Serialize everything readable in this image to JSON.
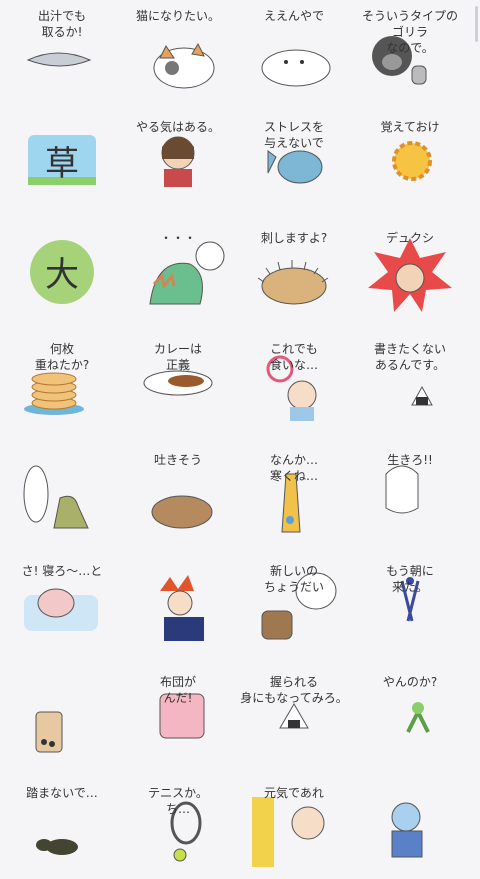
{
  "stickers": [
    {
      "name": "sticker-dashi",
      "lines": [
        "出汁でも",
        "取るか!"
      ]
    },
    {
      "name": "sticker-cat",
      "lines": [
        "猫になりたい。"
      ]
    },
    {
      "name": "sticker-seal",
      "lines": [
        "ええんやで"
      ]
    },
    {
      "name": "sticker-gorilla",
      "lines": [
        "そういうタイプの",
        "ゴリラ",
        "なので。"
      ]
    },
    {
      "name": "sticker-kusa",
      "lines": [
        "草"
      ]
    },
    {
      "name": "sticker-girl",
      "lines": [
        "やる気はある。"
      ]
    },
    {
      "name": "sticker-sunfish",
      "lines": [
        "ストレスを",
        "与えないで"
      ]
    },
    {
      "name": "sticker-sun",
      "lines": [
        "覚えておけ"
      ]
    },
    {
      "name": "sticker-dai",
      "lines": [
        "大"
      ]
    },
    {
      "name": "sticker-dino-dots",
      "lines": [
        "・・・"
      ]
    },
    {
      "name": "sticker-hedgehog",
      "lines": [
        "刺しますよ?"
      ]
    },
    {
      "name": "sticker-deuce",
      "lines": [
        "デュクシ"
      ]
    },
    {
      "name": "sticker-pancake",
      "lines": [
        "何枚",
        "重ねたか?"
      ]
    },
    {
      "name": "sticker-curry",
      "lines": [
        "カレーは",
        "正義"
      ]
    },
    {
      "name": "sticker-baby",
      "lines": [
        "これでも",
        "食いな…"
      ]
    },
    {
      "name": "sticker-onigiri",
      "lines": [
        "書きたくない",
        "あるんです。"
      ]
    },
    {
      "name": "sticker-dino-roar",
      "lines": []
    },
    {
      "name": "sticker-squirrel",
      "lines": [
        "吐きそう"
      ]
    },
    {
      "name": "sticker-giraffe",
      "lines": [
        "なんか…",
        "寒くね…"
      ]
    },
    {
      "name": "sticker-ghost",
      "lines": [
        "生きろ!!"
      ]
    },
    {
      "name": "sticker-pig",
      "lines": [
        "さ! 寝ろ〜…と"
      ]
    },
    {
      "name": "sticker-redhair",
      "lines": []
    },
    {
      "name": "sticker-bear",
      "lines": [
        "新しいの",
        "ちょうだい"
      ]
    },
    {
      "name": "sticker-compass",
      "lines": [
        "もう朝に",
        "来た。"
      ]
    },
    {
      "name": "sticker-boba",
      "lines": []
    },
    {
      "name": "sticker-futon",
      "lines": [
        "布団が",
        "んだ!"
      ]
    },
    {
      "name": "sticker-riceball-thought",
      "lines": [
        "握られる",
        "身にもなってみろ。"
      ]
    },
    {
      "name": "sticker-mantis",
      "lines": [
        "やんのか?"
      ]
    },
    {
      "name": "sticker-ant",
      "lines": [
        "踏まないで…"
      ]
    },
    {
      "name": "sticker-tennis",
      "lines": [
        "テニスか。",
        "ち…"
      ]
    },
    {
      "name": "sticker-genki",
      "lines": [
        "元気であれ"
      ]
    },
    {
      "name": "sticker-overall",
      "lines": []
    }
  ],
  "colors": {
    "bg": "#f5f5f8",
    "ink": "#333333"
  }
}
